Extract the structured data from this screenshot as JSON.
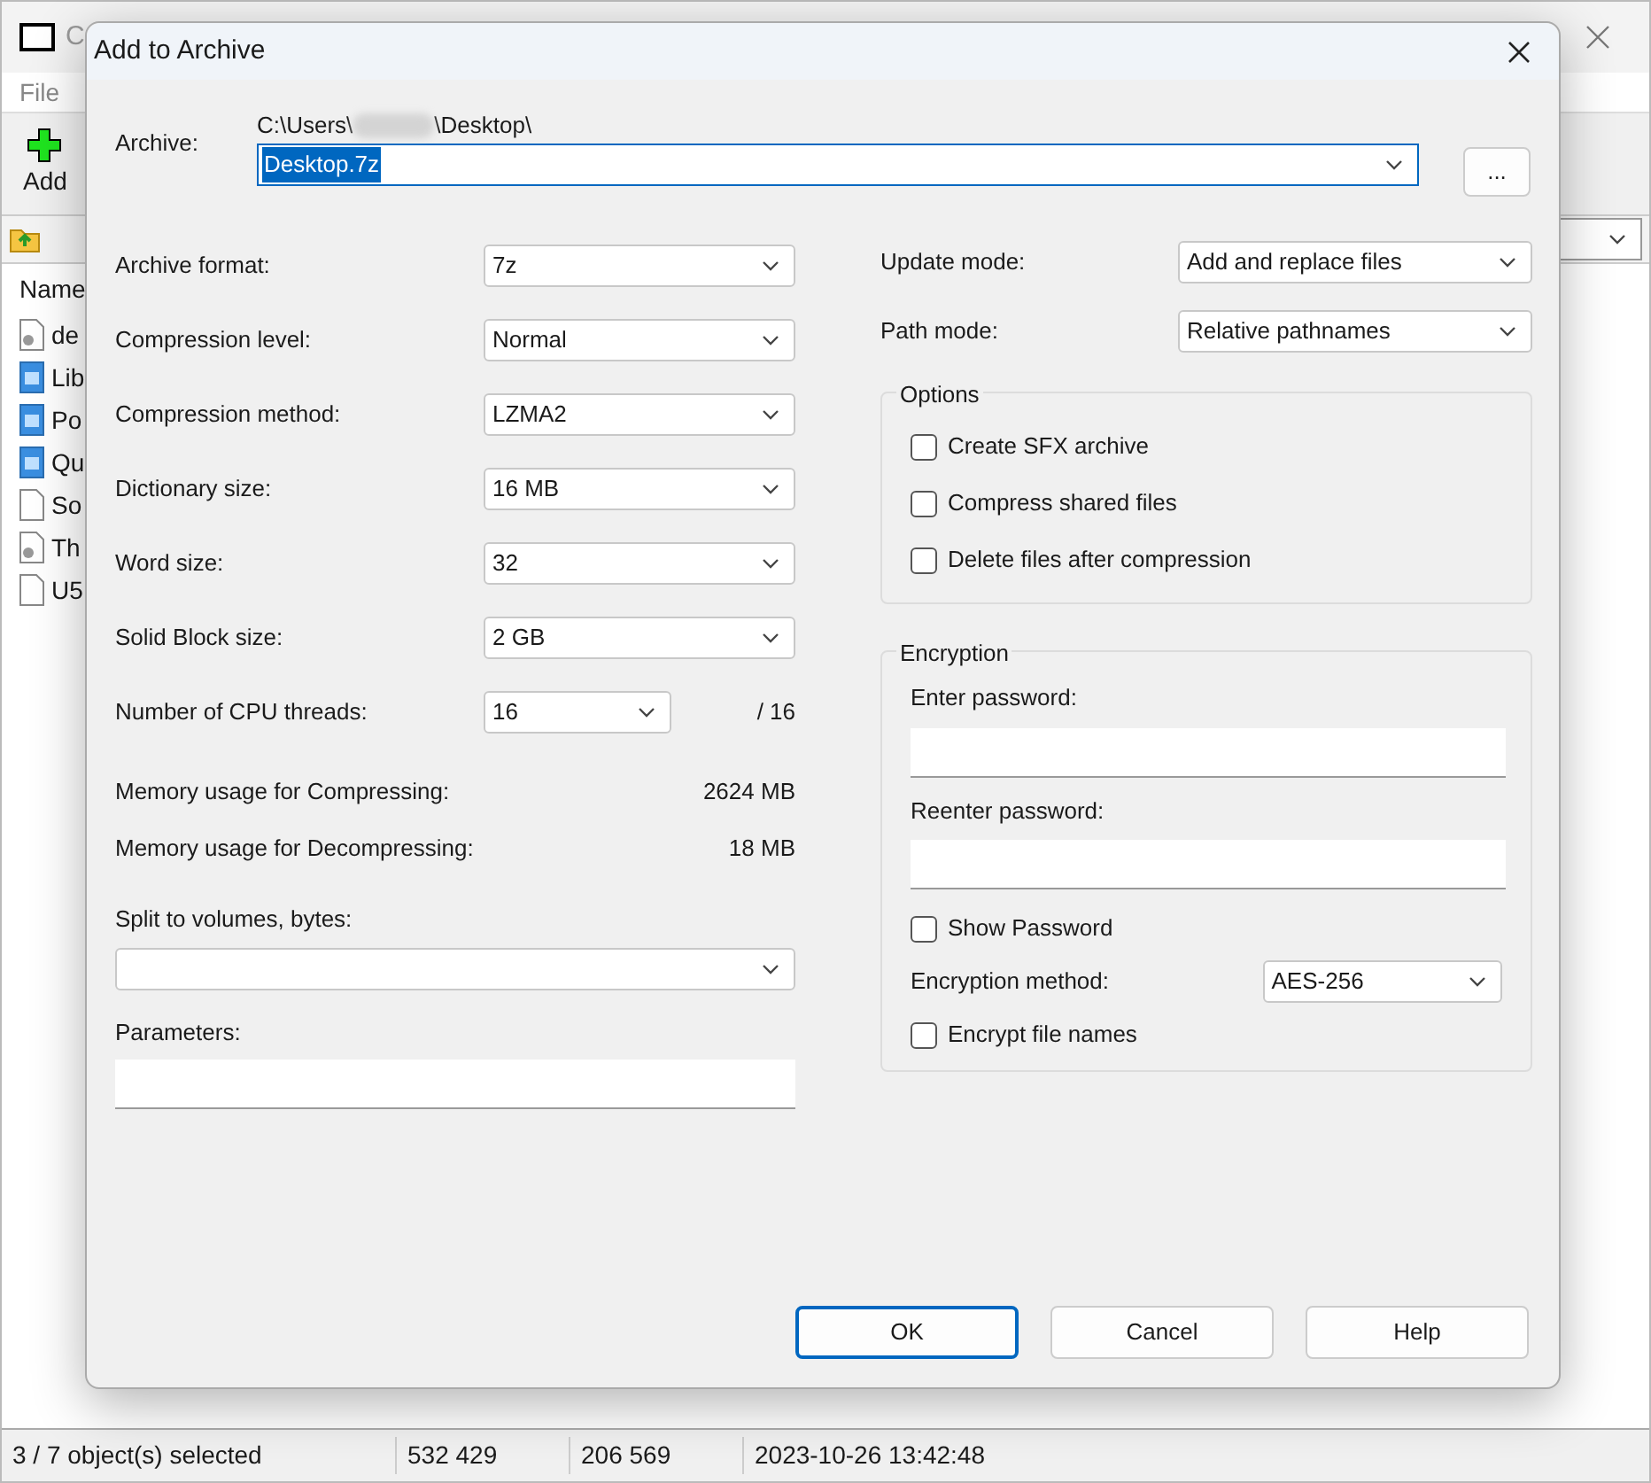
{
  "main_window": {
    "title": "C",
    "menu": [
      "File"
    ],
    "toolbar": [
      {
        "label": "Add"
      }
    ],
    "list_header": "Name",
    "files": [
      {
        "name": "de",
        "kind": "config"
      },
      {
        "name": "Lib",
        "kind": "image"
      },
      {
        "name": "Po",
        "kind": "image"
      },
      {
        "name": "Qu",
        "kind": "image"
      },
      {
        "name": "So",
        "kind": "file"
      },
      {
        "name": "Th",
        "kind": "config"
      },
      {
        "name": "U5",
        "kind": "file"
      }
    ],
    "status_bar": [
      "3 / 7 object(s) selected",
      "532 429",
      "206 569",
      "2023-10-26 13:42:48"
    ]
  },
  "dialog": {
    "title": "Add to Archive",
    "archive_label": "Archive:",
    "path_start": "C:\\Users\\",
    "path_end": "\\Desktop\\",
    "archive_name": "Desktop.7z",
    "browse_button": "...",
    "left_fields": [
      {
        "label": "Archive format:",
        "value": "7z"
      },
      {
        "label": "Compression level:",
        "value": "Normal"
      },
      {
        "label": "Compression method:",
        "value": "LZMA2"
      },
      {
        "label": "Dictionary size:",
        "value": "16 MB"
      },
      {
        "label": "Word size:",
        "value": "32"
      },
      {
        "label": "Solid Block size:",
        "value": "2 GB"
      }
    ],
    "threads": {
      "label": "Number of CPU threads:",
      "value": "16",
      "max": "/ 16"
    },
    "memory": [
      {
        "label": "Memory usage for Compressing:",
        "value": "2624 MB"
      },
      {
        "label": "Memory usage for Decompressing:",
        "value": "18 MB"
      }
    ],
    "split": {
      "label": "Split to volumes, bytes:"
    },
    "parameters": {
      "label": "Parameters:"
    },
    "right_fields": [
      {
        "label": "Update mode:",
        "value": "Add and replace files"
      },
      {
        "label": "Path mode:",
        "value": "Relative pathnames"
      }
    ],
    "options": {
      "title": "Options",
      "items": [
        {
          "label": "Create SFX archive",
          "checked": false
        },
        {
          "label": "Compress shared files",
          "checked": false
        },
        {
          "label": "Delete files after compression",
          "checked": false
        }
      ]
    },
    "encryption": {
      "title": "Encryption",
      "enter_password": "Enter password:",
      "reenter_password": "Reenter password:",
      "show_password": {
        "label": "Show Password",
        "checked": false
      },
      "method_label": "Encryption method:",
      "method": "AES-256",
      "encrypt_names": {
        "label": "Encrypt file names",
        "checked": false
      }
    },
    "buttons": [
      {
        "label": "OK",
        "default": true
      },
      {
        "label": "Cancel",
        "default": false
      },
      {
        "label": "Help",
        "default": false
      }
    ]
  }
}
